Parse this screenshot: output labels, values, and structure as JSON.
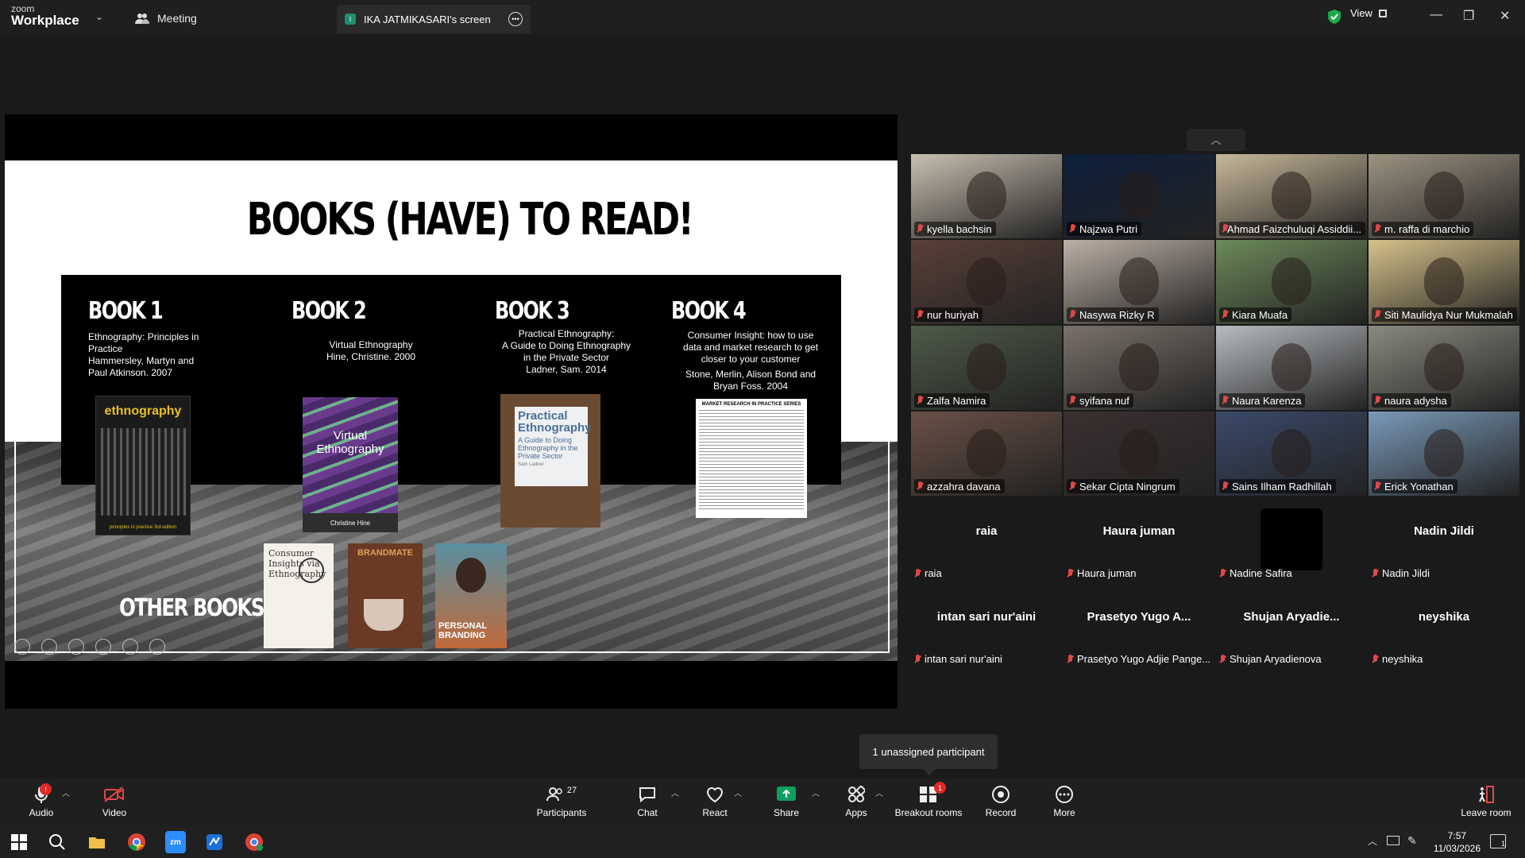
{
  "app": {
    "brand_small": "zoom",
    "brand_big": "Workplace",
    "meeting_tab": "Meeting",
    "screen_tab": "IKA JATMIKASARI's screen",
    "screen_tab_initial": "I",
    "view_label": "View"
  },
  "slide": {
    "title": "BOOKS (HAVE) TO READ!",
    "books": [
      {
        "heading": "BOOK 1",
        "text": [
          "Ethnography: Principles in",
          "Practice",
          "Hammersley, Martyn and",
          "Paul Atkinson. 2007"
        ],
        "cover_title": "ethnography",
        "cover_sub": "principles in practice 3rd edition"
      },
      {
        "heading": "BOOK 2",
        "text": [
          "Virtual Ethnography",
          "Hine, Christine. 2000"
        ],
        "cover_title": "Virtual Ethnography",
        "cover_sub": "Christine Hine"
      },
      {
        "heading": "BOOK 3",
        "text": [
          "Practical Ethnography:",
          "A Guide to Doing Ethnography",
          "in the Private Sector",
          "Ladner, Sam. 2014"
        ],
        "cover_title": "Practical Ethnography",
        "cover_sub": "A Guide to Doing Ethnography in the Private Sector",
        "cover_author": "Sam Ladner"
      },
      {
        "heading": "BOOK 4",
        "text": [
          "Consumer Insight: how to use",
          "data and market research to get",
          "closer to your customer",
          "Stone, Merlin, Alison Bond and",
          "Bryan Foss. 2004"
        ],
        "cover_title": "MARKET RESEARCH IN PRACTICE SERIES"
      }
    ],
    "other_label": "OTHER BOOKS",
    "other_covers": [
      {
        "title": "Consumer Insights via Ethnography"
      },
      {
        "title": "BRANDMATE"
      },
      {
        "title": "PERSONAL BRANDING"
      }
    ]
  },
  "participants_video": [
    {
      "name": "kyella bachsin",
      "color": "#c9c0b0"
    },
    {
      "name": "Najzwa Putri",
      "color": "#0d1f3a"
    },
    {
      "name": "Ahmad Faizchuluqi Assiddii...",
      "color": "#c8b89a"
    },
    {
      "name": "m. raffa di marchio",
      "color": "#9c9280"
    },
    {
      "name": "nur huriyah",
      "color": "#5a4038"
    },
    {
      "name": "Nasywa Rizky R",
      "color": "#bcb0a6"
    },
    {
      "name": "Kiara Muafa",
      "color": "#6c8a5a"
    },
    {
      "name": "Siti Maulidya Nur Mukmalah",
      "color": "#d6c28a"
    },
    {
      "name": "Zalfa Namira",
      "color": "#4e5a48"
    },
    {
      "name": "syifana nuf",
      "color": "#7a726a"
    },
    {
      "name": "Naura Karenza",
      "color": "#b8bcc0"
    },
    {
      "name": "naura adysha",
      "color": "#8a8a80"
    },
    {
      "name": "azzahra davana",
      "color": "#6a5046"
    },
    {
      "name": "Sekar Cipta Ningrum",
      "color": "#3a3030"
    },
    {
      "name": "Sains Ilham Radhillah",
      "color": "#3a4a6a"
    },
    {
      "name": "Erick Yonathan",
      "color": "#7a9ab8"
    }
  ],
  "participants_novideo": [
    {
      "big": "raia",
      "small": "raia"
    },
    {
      "big": "Haura juman",
      "small": "Haura juman"
    },
    {
      "big": "",
      "small": "Nadine Safira"
    },
    {
      "big": "Nadin Jildi",
      "small": "Nadin Jildi"
    },
    {
      "big": "intan sari nur'aini",
      "small": "intan sari nur'aini"
    },
    {
      "big": "Prasetyo Yugo A...",
      "small": "Prasetyo Yugo Adjie Pange..."
    },
    {
      "big": "Shujan  Aryadie...",
      "small": "Shujan Aryadienova"
    },
    {
      "big": "neyshika",
      "small": "neyshika"
    }
  ],
  "tooltip": "1 unassigned participant",
  "toolbar": {
    "audio": "Audio",
    "video": "Video",
    "participants": "Participants",
    "participants_count": "27",
    "chat": "Chat",
    "react": "React",
    "share": "Share",
    "apps": "Apps",
    "breakout": "Breakout rooms",
    "breakout_badge": "1",
    "record": "Record",
    "more": "More",
    "leave": "Leave room",
    "audio_badge": "!"
  },
  "taskbar": {
    "time": "7:57",
    "date": "11/03/2026",
    "notif": "1"
  },
  "colors": {
    "accent_green": "#0e9f5e",
    "danger": "#e02828"
  }
}
